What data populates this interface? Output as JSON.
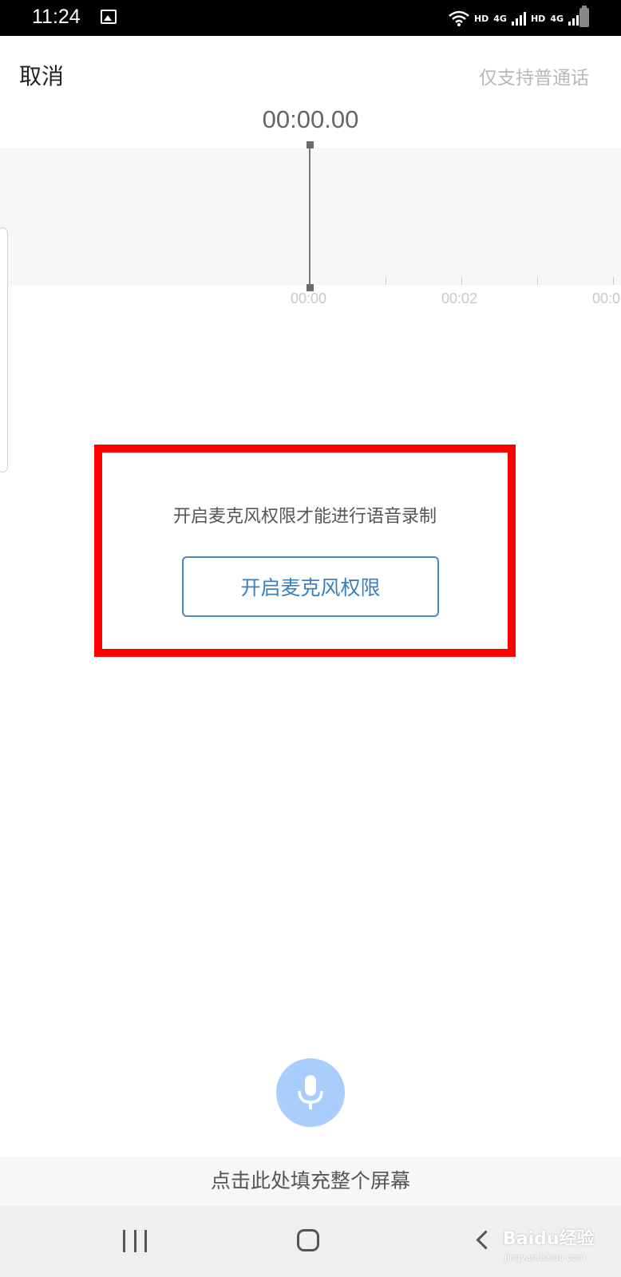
{
  "status_bar": {
    "time": "11:24",
    "network_labels": [
      "HD",
      "4G",
      "HD",
      "4G"
    ],
    "icons": [
      "image-icon",
      "wifi-icon",
      "signal-icon",
      "battery-icon"
    ]
  },
  "header": {
    "cancel_label": "取消",
    "language_note": "仅支持普通话"
  },
  "recorder": {
    "timer": "00:00.00",
    "timeline_labels": [
      "00:00",
      "00:02",
      "00:0"
    ]
  },
  "permission": {
    "message": "开启麦克风权限才能进行语音录制",
    "button_label": "开启麦克风权限",
    "highlight_color": "#ff0000"
  },
  "mic": {
    "icon": "microphone-icon",
    "color": "#a9cdfd"
  },
  "fill_screen": {
    "label": "点击此处填充整个屏幕"
  },
  "nav_bar": {
    "icons": [
      "recent-apps-icon",
      "home-icon",
      "back-icon"
    ]
  },
  "watermark": {
    "text": "Baidu经验",
    "sub": "jingyan.baidu.com"
  }
}
